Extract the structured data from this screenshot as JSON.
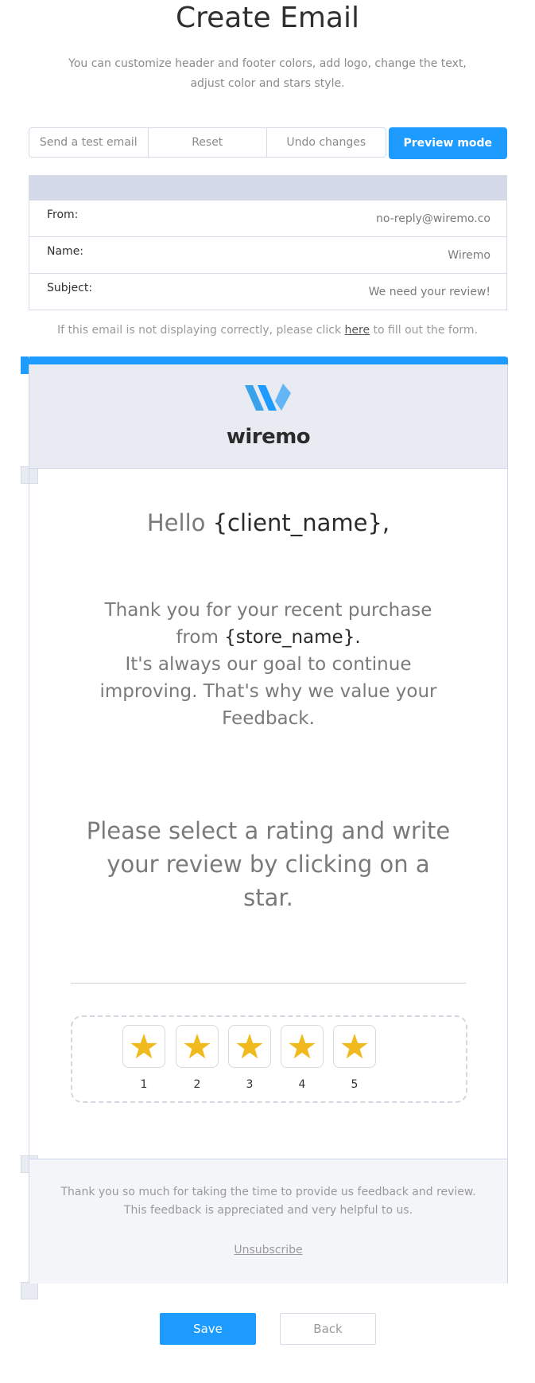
{
  "page": {
    "title": "Create Email",
    "subtitle_line1": "You can customize header and footer colors, add logo, change the text,",
    "subtitle_line2": "adjust color and stars style."
  },
  "toolbar": {
    "send_test": "Send a test email",
    "reset": "Reset",
    "undo": "Undo changes",
    "preview": "Preview mode"
  },
  "meta": {
    "from_label": "From:",
    "from_value": "no-reply@wiremo.co",
    "name_label": "Name:",
    "name_value": "Wiremo",
    "subject_label": "Subject:",
    "subject_value": "We need your review!"
  },
  "notice": {
    "before": "If this email is not displaying correctly, please click ",
    "link": "here",
    "after": " to fill out the form."
  },
  "email": {
    "logo_text": "wiremo",
    "hello_prefix": "Hello ",
    "hello_var": "{client_name},",
    "thanks_line1": "Thank you for your recent purchase",
    "thanks_from": "from ",
    "thanks_var": "{store_name}.",
    "thanks_rest": "It's always our goal to continue improving. That's why we value your Feedback.",
    "cta": "Please select a rating and write your review by clicking on a star.",
    "stars": [
      "1",
      "2",
      "3",
      "4",
      "5"
    ],
    "footer_line1": "Thank you so much for taking the time to provide us feedback and review.",
    "footer_line2": "This feedback is appreciated and very helpful to us.",
    "unsubscribe": "Unsubscribe"
  },
  "actions": {
    "save": "Save",
    "back": "Back"
  },
  "colors": {
    "accent": "#1e9bff",
    "star": "#f0b91e",
    "header_bg": "#e8ebf2",
    "meta_head_bg": "#d4d9ea"
  }
}
